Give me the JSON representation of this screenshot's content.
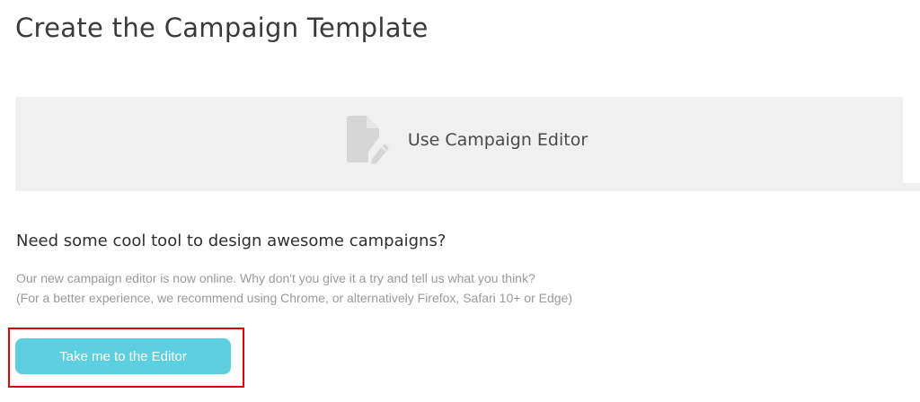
{
  "page": {
    "title": "Create the Campaign Template"
  },
  "editor_card": {
    "label": "Use Campaign Editor",
    "icon": "document-edit-icon"
  },
  "promo": {
    "heading": "Need some cool tool to design awesome campaigns?",
    "line1": "Our new campaign editor is now online. Why don't you give it a try and tell us what you think?",
    "line2": "(For a better experience, we recommend using Chrome, or alternatively Firefox, Safari 10+ or Edge)"
  },
  "cta": {
    "label": "Take me to the Editor"
  },
  "colors": {
    "accent": "#5ccfe0",
    "card_background": "#f0f0f0",
    "highlight": "#e00000"
  }
}
